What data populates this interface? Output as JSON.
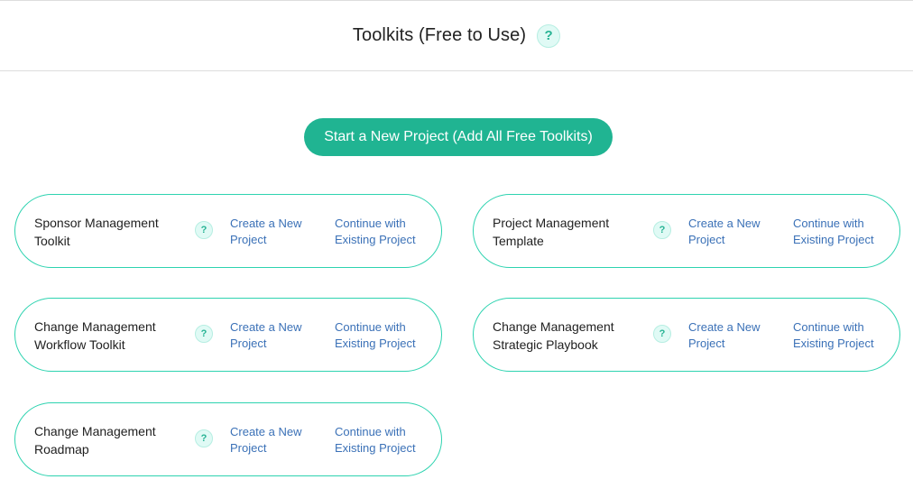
{
  "header": {
    "title": "Toolkits (Free to Use)",
    "help_symbol": "?"
  },
  "start_button": {
    "label": "Start a New Project (Add All Free Toolkits)"
  },
  "colors": {
    "accent": "#20b492",
    "card_border": "#2ed3b0",
    "link": "#3b71b7",
    "help_bg": "#e0faf5"
  },
  "toolkits": [
    {
      "title": "Sponsor Management Toolkit",
      "help_symbol": "?",
      "create_label": "Create a New Project",
      "continue_label": "Continue with Existing Project"
    },
    {
      "title": "Project Management Template",
      "help_symbol": "?",
      "create_label": "Create a New Project",
      "continue_label": "Continue with Existing Project"
    },
    {
      "title": "Change Management Workflow Toolkit",
      "help_symbol": "?",
      "create_label": "Create a New Project",
      "continue_label": "Continue with Existing Project"
    },
    {
      "title": "Change Management Strategic Playbook",
      "help_symbol": "?",
      "create_label": "Create a New Project",
      "continue_label": "Continue with Existing Project"
    },
    {
      "title": "Change Management Roadmap",
      "help_symbol": "?",
      "create_label": "Create a New Project",
      "continue_label": "Continue with Existing Project"
    }
  ]
}
